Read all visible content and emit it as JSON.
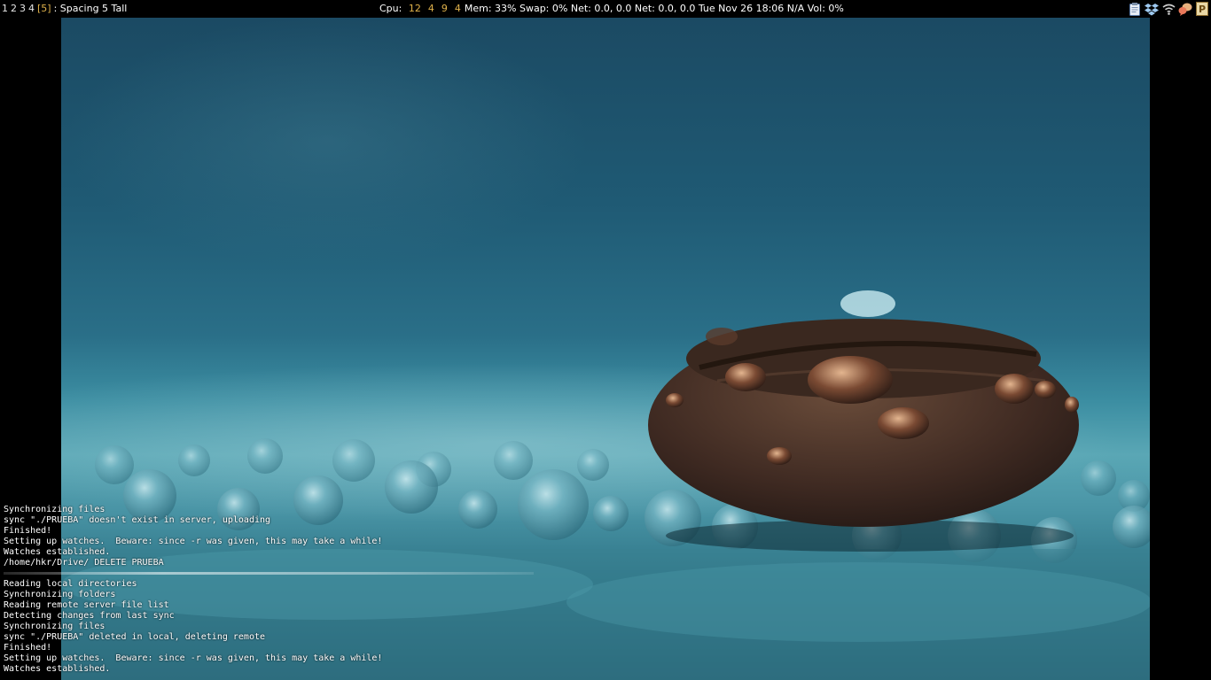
{
  "statusbar": {
    "workspaces": [
      "1",
      "2",
      "3",
      "4"
    ],
    "current_workspace": "[5]",
    "layout_title": ": Spacing 5 Tall",
    "cpu_label": "Cpu:",
    "cpu_values": [
      "12",
      "4",
      "9",
      "4"
    ],
    "mem": "Mem: 33%",
    "swap": "Swap: 0%",
    "net1": "Net: 0.0, 0.0",
    "net2": "Net: 0.0, 0.0",
    "datetime": "Tue Nov 26 18:06",
    "battery": "N/A",
    "volume": "Vol: 0%",
    "tray_icons": [
      "clipboard-icon",
      "dropbox-icon",
      "wifi-icon",
      "pidgin-icon",
      "parcellite-icon"
    ],
    "accent_color": "#e0b24b"
  },
  "terminal": {
    "lines_top": [
      "Synchronizing files",
      "sync \"./PRUEBA\" doesn't exist in server, uploading",
      "Finished!",
      "Setting up watches.  Beware: since -r was given, this may take a while!",
      "Watches established.",
      "/home/hkr/Drive/ DELETE PRUEBA"
    ],
    "lines_bottom": [
      "Reading local directories",
      "Synchronizing folders",
      "Reading remote server file list",
      "Detecting changes from last sync",
      "Synchronizing files",
      "sync \"./PRUEBA\" deleted in local, deleting remote",
      "Finished!",
      "Setting up watches.  Beware: since -r was given, this may take a while!",
      "Watches established."
    ]
  }
}
